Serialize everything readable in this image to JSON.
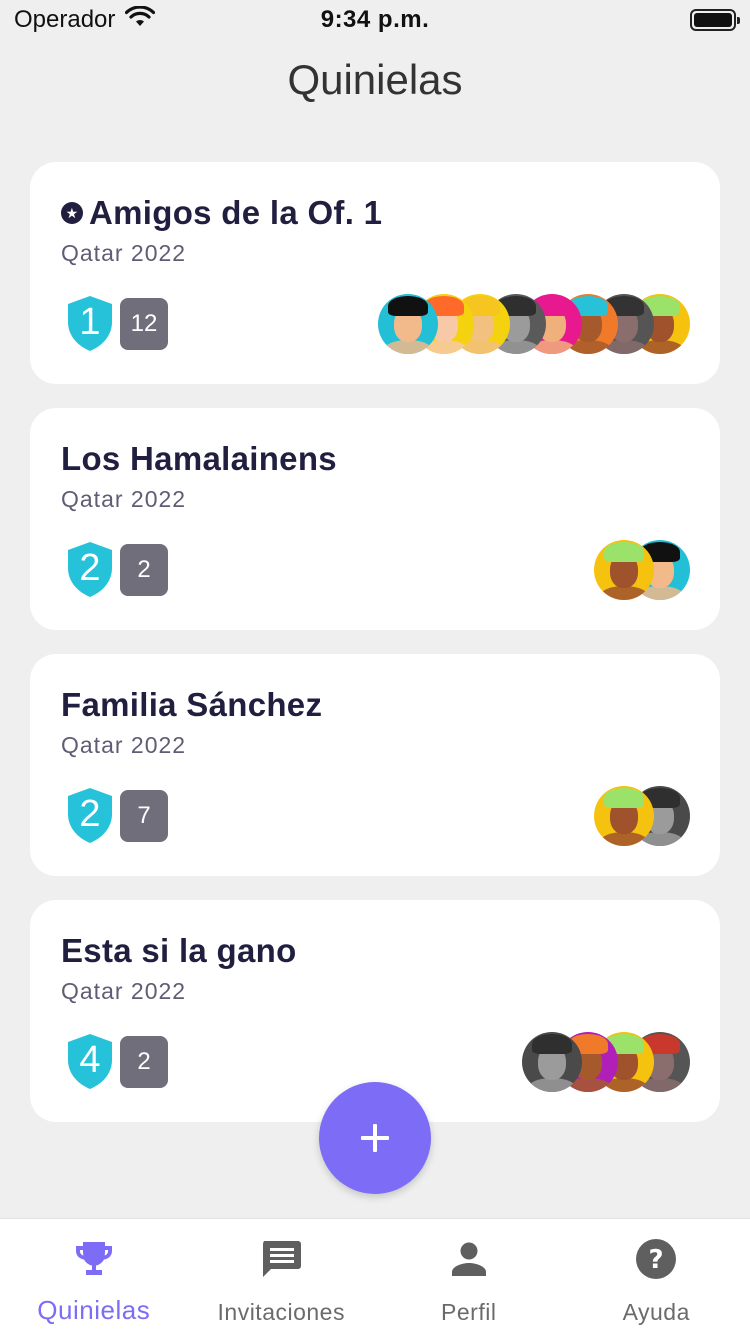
{
  "status": {
    "carrier": "Operador",
    "time": "9:34 p.m."
  },
  "header": {
    "title": "Quinielas"
  },
  "colors": {
    "accent": "#7d6cf6",
    "shield": "#26c2da",
    "badge": "#706e7b",
    "title_text": "#211f3f"
  },
  "cards": [
    {
      "title": "Amigos de la Of. 1",
      "starred": true,
      "subtitle": "Qatar 2022",
      "rank": "1",
      "members": "12",
      "avatars": [
        {
          "bg": "#22bfd6",
          "skin": "#f2b98a",
          "hair": "#111111"
        },
        {
          "bg": "#f5d20f",
          "skin": "#f7c9a6",
          "hair": "#ff6a2b"
        },
        {
          "bg": "#f5d20f",
          "skin": "#f2c07f",
          "hair": "#f7c51f"
        },
        {
          "bg": "#5a5a5a",
          "skin": "#9b9b9b",
          "hair": "#2f2f2f"
        },
        {
          "bg": "#e8188f",
          "skin": "#f0b07c",
          "hair": "#e8188f"
        },
        {
          "bg": "#f07a2a",
          "skin": "#a65a2c",
          "hair": "#27c1d8"
        },
        {
          "bg": "#555555",
          "skin": "#8a6d6d",
          "hair": "#333333"
        },
        {
          "bg": "#f5c20f",
          "skin": "#a0522d",
          "hair": "#9be26b"
        }
      ]
    },
    {
      "title": "Los Hamalainens",
      "starred": false,
      "subtitle": "Qatar 2022",
      "rank": "2",
      "members": "2",
      "avatars": [
        {
          "bg": "#f5c20f",
          "skin": "#a0522d",
          "hair": "#9be26b"
        },
        {
          "bg": "#22bfd6",
          "skin": "#f2b98a",
          "hair": "#111111"
        }
      ]
    },
    {
      "title": "Familia Sánchez",
      "starred": false,
      "subtitle": "Qatar 2022",
      "rank": "2",
      "members": "7",
      "avatars": [
        {
          "bg": "#f5c20f",
          "skin": "#a0522d",
          "hair": "#9be26b"
        },
        {
          "bg": "#4a4a4a",
          "skin": "#9b9b9b",
          "hair": "#2f2f2f"
        }
      ]
    },
    {
      "title": "Esta si la gano",
      "starred": false,
      "subtitle": "Qatar 2022",
      "rank": "4",
      "members": "2",
      "avatars": [
        {
          "bg": "#4a4a4a",
          "skin": "#9b9b9b",
          "hair": "#2f2f2f"
        },
        {
          "bg": "#b01fb8",
          "skin": "#a65a2c",
          "hair": "#f07a2a"
        },
        {
          "bg": "#f5c20f",
          "skin": "#a0522d",
          "hair": "#9be26b"
        },
        {
          "bg": "#555555",
          "skin": "#8a6d6d",
          "hair": "#c8382c"
        }
      ]
    }
  ],
  "fab": {
    "icon": "plus-icon"
  },
  "tabs": [
    {
      "label": "Quinielas",
      "icon": "trophy-icon",
      "active": true
    },
    {
      "label": "Invitaciones",
      "icon": "message-icon",
      "active": false
    },
    {
      "label": "Perfil",
      "icon": "person-icon",
      "active": false
    },
    {
      "label": "Ayuda",
      "icon": "help-icon",
      "active": false
    }
  ]
}
